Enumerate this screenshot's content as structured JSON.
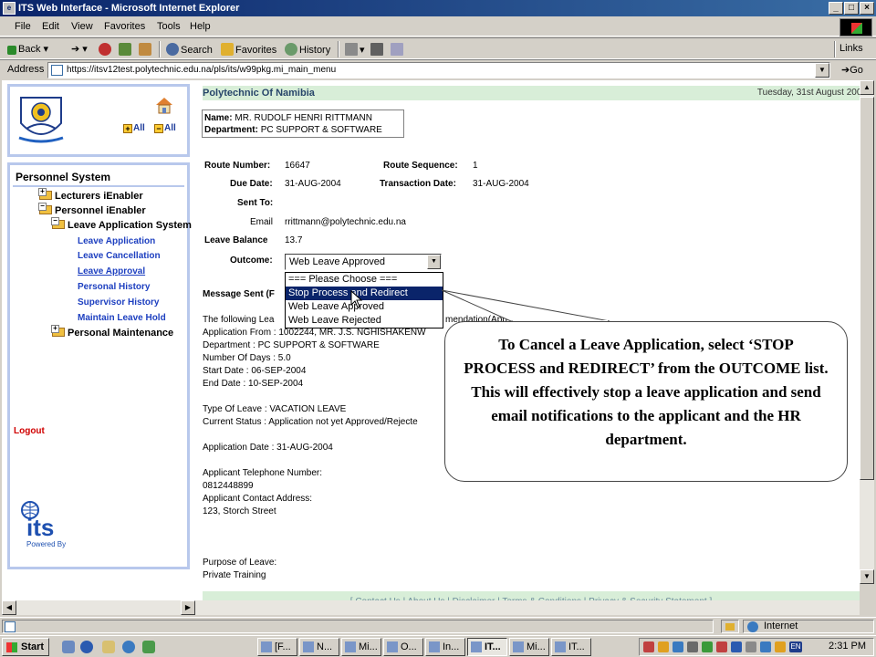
{
  "window": {
    "title": "ITS Web Interface - Microsoft Internet Explorer",
    "icon": "ie-page-icon"
  },
  "menu": [
    "File",
    "Edit",
    "View",
    "Favorites",
    "Tools",
    "Help"
  ],
  "toolbar": {
    "back": "Back",
    "search": "Search",
    "favorites": "Favorites",
    "history": "History",
    "links": "Links"
  },
  "address": {
    "label": "Address",
    "url": "https://itsv12test.polytechnic.edu.na/pls/its/w99pkg.mi_main_menu",
    "go": "Go"
  },
  "sidebar": {
    "all_expand": "All",
    "all_collapse": "All",
    "title": "Personnel System",
    "items": [
      {
        "label": "Lecturers iEnabler",
        "type": "folder"
      },
      {
        "label": "Personnel iEnabler",
        "type": "folder-open"
      },
      {
        "label": "Leave Application System",
        "type": "folder-open"
      },
      {
        "label": "Leave Application",
        "type": "link"
      },
      {
        "label": "Leave Cancellation",
        "type": "link"
      },
      {
        "label": "Leave Approval",
        "type": "link-active"
      },
      {
        "label": "Personal History",
        "type": "link"
      },
      {
        "label": "Supervisor History",
        "type": "link"
      },
      {
        "label": "Maintain Leave Hold",
        "type": "link"
      },
      {
        "label": "Personal Maintenance",
        "type": "folder"
      }
    ],
    "logout": "Logout",
    "powered_by": "Powered By",
    "its_logo_text": "its"
  },
  "header": {
    "institution": "Polytechnic Of Namibia",
    "date": "Tuesday, 31st August 2004"
  },
  "person": {
    "name_label": "Name:",
    "name": "MR. RUDOLF HENRI RITTMANN",
    "dept_label": "Department:",
    "dept": "PC SUPPORT & SOFTWARE"
  },
  "form": {
    "route_number_label": "Route Number:",
    "route_number": "16647",
    "route_sequence_label": "Route Sequence:",
    "route_sequence": "1",
    "due_date_label": "Due Date:",
    "due_date": "31-AUG-2004",
    "transaction_date_label": "Transaction Date:",
    "transaction_date": "31-AUG-2004",
    "sent_to_label": "Sent To:",
    "email_label": "Email",
    "email": "rrittmann@polytechnic.edu.na",
    "leave_balance_label": "Leave Balance",
    "leave_balance": "13.7",
    "outcome_label": "Outcome:",
    "outcome_selected": "Web Leave Approved",
    "outcome_options": [
      "=== Please Choose ===",
      "Stop Process and Redirect",
      "Web Leave Approved",
      "Web Leave Rejected"
    ],
    "message_sent_label": "Message Sent (F"
  },
  "message": {
    "line1": "The following Lea",
    "line1_tail": "mendation(App",
    "line2": "Application From : 1002244, MR. J.S. NGHISHAKENW",
    "line3": "Department : PC SUPPORT & SOFTWARE",
    "line4": "Number Of Days : 5.0",
    "line5": "Start Date : 06-SEP-2004",
    "line6": "End Date : 10-SEP-2004",
    "line7": "Type Of Leave : VACATION LEAVE",
    "line8": "Current Status : Application not yet Approved/Rejecte",
    "line9": "Application Date : 31-AUG-2004",
    "line10": "Applicant Telephone Number:",
    "line11": "0812448899",
    "line12": "Applicant Contact Address:",
    "line13": "123, Storch Street",
    "line14": "Purpose of Leave:",
    "line15": "Private Training"
  },
  "footer": "[ Contact Us | About Us | Disclaimer | Terms & Conditions | Privacy & Security Statement ]",
  "callout": "To Cancel a Leave Application, select ‘STOP PROCESS and REDIRECT’ from the OUTCOME list. This will effectively stop a leave application and send email notifications to the applicant and the HR department.",
  "status": {
    "zone": "Internet"
  },
  "taskbar": {
    "start": "Start",
    "tasks": [
      "[F...",
      "N...",
      "Mi...",
      "O...",
      "In...",
      "IT...",
      "Mi...",
      "IT..."
    ],
    "active_index": 5,
    "lang": "EN",
    "clock": "2:31 PM"
  }
}
